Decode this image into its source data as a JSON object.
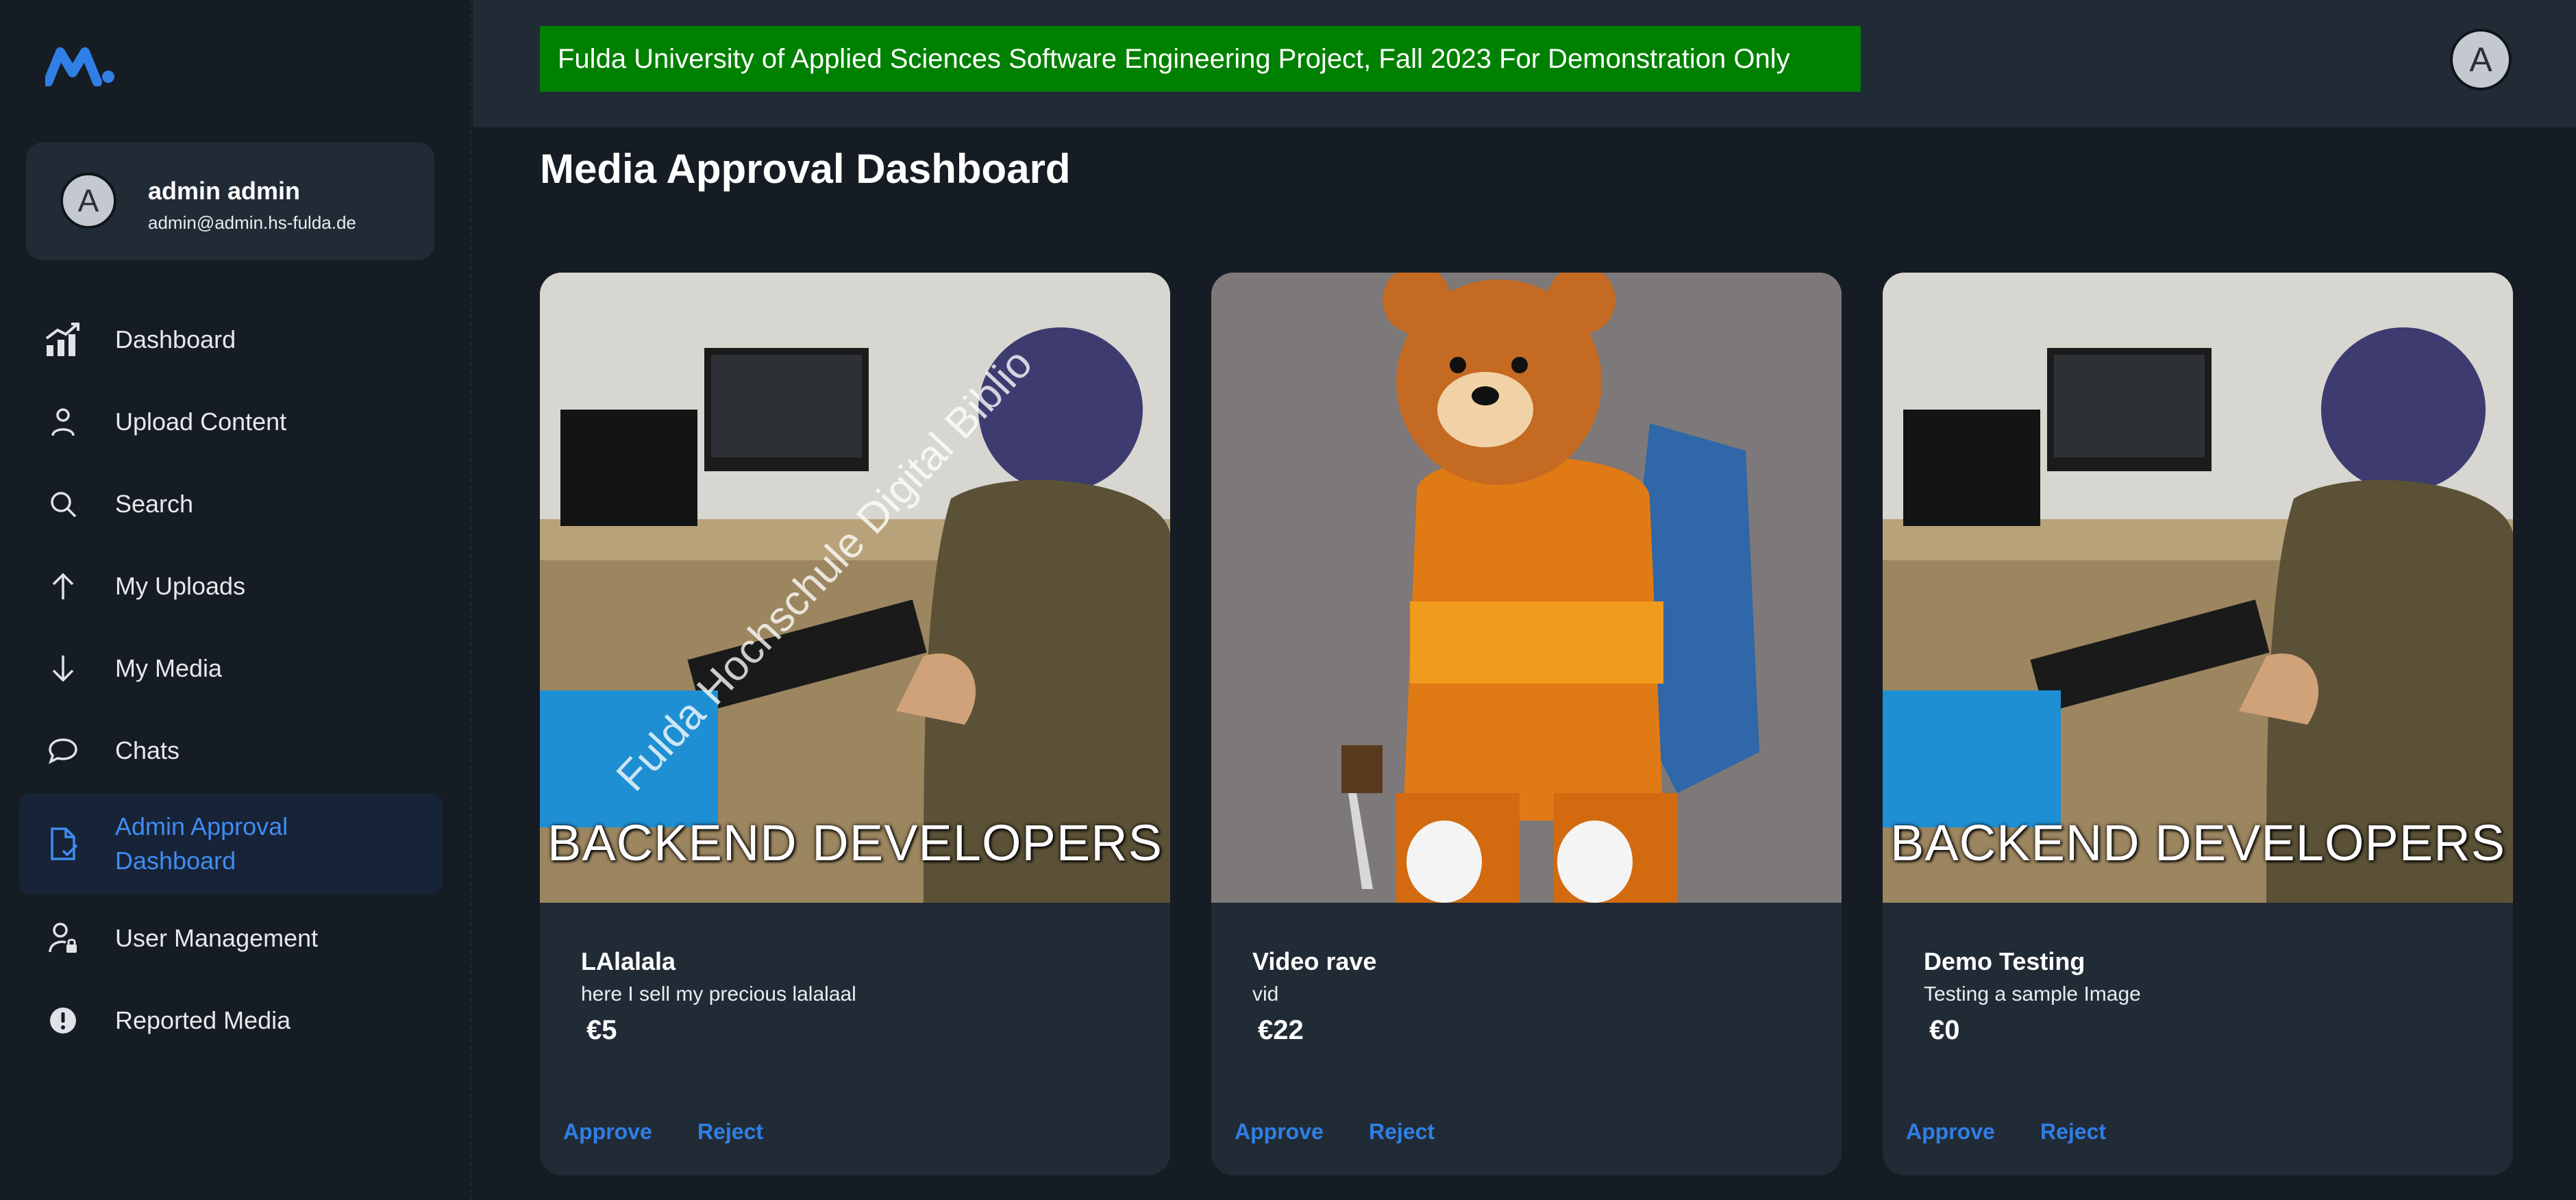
{
  "sidebar": {
    "user": {
      "avatar_letter": "A",
      "name": "admin admin",
      "email": "admin@admin.hs-fulda.de"
    },
    "items": [
      {
        "label": "Dashboard",
        "icon": "chart-trend-icon"
      },
      {
        "label": "Upload Content",
        "icon": "person-icon"
      },
      {
        "label": "Search",
        "icon": "search-icon"
      },
      {
        "label": "My Uploads",
        "icon": "arrow-up-icon"
      },
      {
        "label": "My Media",
        "icon": "arrow-down-icon"
      },
      {
        "label": "Chats",
        "icon": "chat-bubble-icon"
      },
      {
        "label": "Admin Approval Dashboard",
        "icon": "document-check-icon",
        "active": true
      },
      {
        "label": "User Management",
        "icon": "user-lock-icon"
      },
      {
        "label": "Reported Media",
        "icon": "alert-icon"
      }
    ]
  },
  "header": {
    "banner": "Fulda University of Applied Sciences Software Engineering Project, Fall 2023 For Demonstration Only",
    "avatar_letter": "A"
  },
  "page": {
    "title": "Media Approval Dashboard"
  },
  "cards": [
    {
      "title": "LAlalala",
      "description": "here I sell my precious lalalaal",
      "price": "€5",
      "approve": "Approve",
      "reject": "Reject",
      "image_caption": "BACKEND DEVELOPERS",
      "watermark": "Fulda Hochschule Digital Biblio"
    },
    {
      "title": "Video rave",
      "description": "vid",
      "price": "€22",
      "approve": "Approve",
      "reject": "Reject"
    },
    {
      "title": "Demo Testing",
      "description": "Testing a sample Image",
      "price": "€0",
      "approve": "Approve",
      "reject": "Reject",
      "image_caption": "BACKEND DEVELOPERS"
    }
  ],
  "colors": {
    "accent": "#2f7fe6",
    "banner": "#008000",
    "background": "#161c24",
    "card": "#212b36"
  }
}
